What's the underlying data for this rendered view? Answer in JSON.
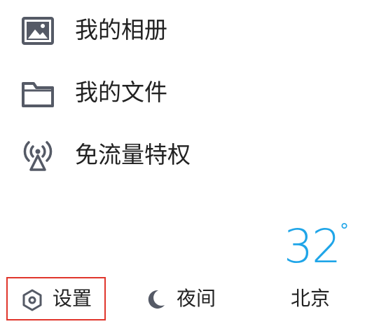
{
  "menu": {
    "items": [
      {
        "label": "我的相册",
        "icon": "image-icon"
      },
      {
        "label": "我的文件",
        "icon": "folder-icon"
      },
      {
        "label": "免流量特权",
        "icon": "antenna-icon"
      }
    ]
  },
  "weather": {
    "temperature": "32",
    "degree_symbol": "°",
    "city": "北京",
    "color": "#1fa5e8"
  },
  "bottom_bar": {
    "settings_label": "设置",
    "night_label": "夜间",
    "settings_icon": "hexagon-settings-icon",
    "night_icon": "moon-icon",
    "highlight_color": "#e0362c"
  }
}
